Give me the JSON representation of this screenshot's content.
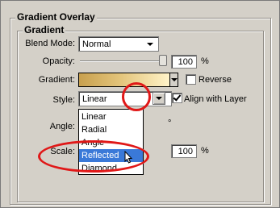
{
  "section": {
    "title": "Gradient Overlay",
    "group_title": "Gradient"
  },
  "blend_mode": {
    "label": "Blend Mode:",
    "value": "Normal"
  },
  "opacity": {
    "label": "Opacity:",
    "value": "100",
    "unit": "%",
    "level": 100
  },
  "gradient": {
    "label": "Gradient:",
    "reverse_label": "Reverse",
    "reverse_checked": false
  },
  "style": {
    "label": "Style:",
    "value": "Linear",
    "align_label": "Align with Layer",
    "align_checked": true,
    "options": [
      "Linear",
      "Radial",
      "Angle",
      "Reflected",
      "Diamond"
    ],
    "highlighted": "Reflected"
  },
  "angle": {
    "label": "Angle:",
    "degree_symbol": "°"
  },
  "scale": {
    "label": "Scale:",
    "value": "100",
    "unit": "%"
  },
  "colors": {
    "dialog_bg": "#d4d0c8",
    "highlight": "#3a79d8",
    "annotation_red": "#e01818",
    "gradient_start": "#c8a04e",
    "gradient_end": "#fff3c8"
  },
  "icons": [
    "dropdown-arrow-icon",
    "checkmark-icon",
    "pointer-cursor-icon"
  ]
}
